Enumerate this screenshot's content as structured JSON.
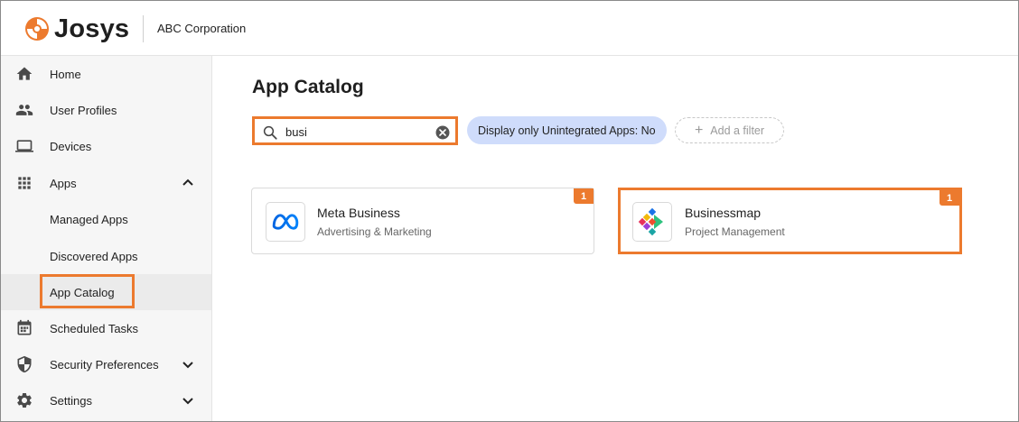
{
  "header": {
    "brand": "Josys",
    "organization": "ABC Corporation",
    "accent_color": "#ec7a2e"
  },
  "sidebar": {
    "items": [
      {
        "label": "Home",
        "icon": "home-icon"
      },
      {
        "label": "User Profiles",
        "icon": "users-icon"
      },
      {
        "label": "Devices",
        "icon": "laptop-icon"
      },
      {
        "label": "Apps",
        "icon": "apps-grid-icon",
        "expanded": true
      },
      {
        "label": "Managed Apps"
      },
      {
        "label": "Discovered Apps"
      },
      {
        "label": "App Catalog",
        "active": true
      },
      {
        "label": "Scheduled Tasks",
        "icon": "calendar-icon"
      },
      {
        "label": "Security Preferences",
        "icon": "shield-icon",
        "expanded": false
      },
      {
        "label": "Settings",
        "icon": "gear-icon",
        "expanded": false
      }
    ]
  },
  "main": {
    "title": "App Catalog",
    "search": {
      "value": "busi"
    },
    "filter_chip": "Display only Unintegrated Apps: No",
    "add_filter": "Add a filter",
    "cards": [
      {
        "name": "Meta Business",
        "category": "Advertising & Marketing",
        "badge": "1",
        "icon": "meta-logo-icon"
      },
      {
        "name": "Businessmap",
        "category": "Project Management",
        "badge": "1",
        "icon": "businessmap-logo-icon"
      }
    ]
  }
}
